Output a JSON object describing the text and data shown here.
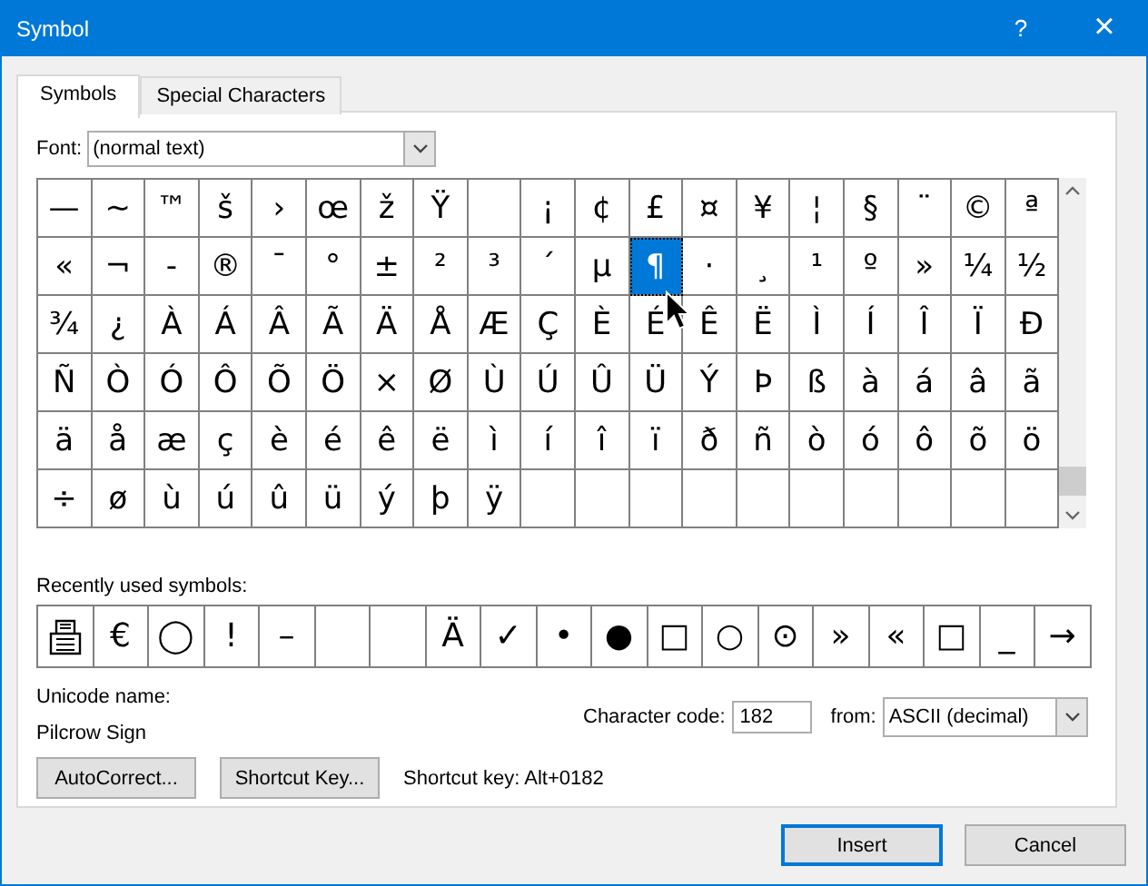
{
  "window": {
    "title": "Symbol",
    "help": "?",
    "close": "×"
  },
  "tabs": [
    {
      "label": "Symbols",
      "selected": true
    },
    {
      "label": "Special Characters",
      "selected": false
    }
  ],
  "font": {
    "label": "Font:",
    "value": "(normal text)"
  },
  "grid": {
    "rows": [
      [
        {
          "char": "—",
          "selected": false
        },
        {
          "char": "~",
          "selected": false
        },
        {
          "char": "™",
          "selected": false
        },
        {
          "char": "š",
          "selected": false
        },
        {
          "char": "›",
          "selected": false
        },
        {
          "char": "œ",
          "selected": false
        },
        {
          "char": "ž",
          "selected": false
        },
        {
          "char": "Ÿ",
          "selected": false
        },
        {
          "kind": "blank",
          "selected": false
        },
        {
          "char": "¡",
          "selected": false
        },
        {
          "char": "¢",
          "selected": false
        },
        {
          "char": "£",
          "selected": false
        },
        {
          "char": "¤",
          "selected": false
        },
        {
          "char": "¥",
          "selected": false
        },
        {
          "char": "¦",
          "selected": false
        },
        {
          "char": "§",
          "selected": false
        },
        {
          "char": "¨",
          "selected": false
        },
        {
          "char": "©",
          "selected": false
        },
        {
          "char": "ª",
          "selected": false
        }
      ],
      [
        {
          "char": "«",
          "selected": false
        },
        {
          "char": "¬",
          "selected": false
        },
        {
          "char": "-",
          "selected": false
        },
        {
          "char": "®",
          "selected": false
        },
        {
          "char": "¯",
          "selected": false
        },
        {
          "char": "°",
          "selected": false
        },
        {
          "char": "±",
          "selected": false
        },
        {
          "char": "²",
          "selected": false
        },
        {
          "char": "³",
          "selected": false
        },
        {
          "char": "´",
          "selected": false
        },
        {
          "char": "µ",
          "selected": false
        },
        {
          "char": "¶",
          "selected": true
        },
        {
          "char": "·",
          "selected": false
        },
        {
          "char": "¸",
          "selected": false
        },
        {
          "char": "¹",
          "selected": false
        },
        {
          "char": "º",
          "selected": false
        },
        {
          "char": "»",
          "selected": false
        },
        {
          "char": "¼",
          "selected": false
        },
        {
          "char": "½",
          "selected": false
        }
      ],
      [
        {
          "char": "¾",
          "selected": false
        },
        {
          "char": "¿",
          "selected": false
        },
        {
          "char": "À",
          "selected": false
        },
        {
          "char": "Á",
          "selected": false
        },
        {
          "char": "Â",
          "selected": false
        },
        {
          "char": "Ã",
          "selected": false
        },
        {
          "char": "Ä",
          "selected": false
        },
        {
          "char": "Å",
          "selected": false
        },
        {
          "char": "Æ",
          "selected": false
        },
        {
          "char": "Ç",
          "selected": false
        },
        {
          "char": "È",
          "selected": false
        },
        {
          "char": "É",
          "selected": false
        },
        {
          "char": "Ê",
          "selected": false
        },
        {
          "char": "Ë",
          "selected": false
        },
        {
          "char": "Ì",
          "selected": false
        },
        {
          "char": "Í",
          "selected": false
        },
        {
          "char": "Î",
          "selected": false
        },
        {
          "char": "Ï",
          "selected": false
        },
        {
          "char": "Ð",
          "selected": false
        }
      ],
      [
        {
          "char": "Ñ",
          "selected": false
        },
        {
          "char": "Ò",
          "selected": false
        },
        {
          "char": "Ó",
          "selected": false
        },
        {
          "char": "Ô",
          "selected": false
        },
        {
          "char": "Õ",
          "selected": false
        },
        {
          "char": "Ö",
          "selected": false
        },
        {
          "char": "×",
          "selected": false
        },
        {
          "char": "Ø",
          "selected": false
        },
        {
          "char": "Ù",
          "selected": false
        },
        {
          "char": "Ú",
          "selected": false
        },
        {
          "char": "Û",
          "selected": false
        },
        {
          "char": "Ü",
          "selected": false
        },
        {
          "char": "Ý",
          "selected": false
        },
        {
          "char": "Þ",
          "selected": false
        },
        {
          "char": "ß",
          "selected": false
        },
        {
          "char": "à",
          "selected": false
        },
        {
          "char": "á",
          "selected": false
        },
        {
          "char": "â",
          "selected": false
        },
        {
          "char": "ã",
          "selected": false
        }
      ],
      [
        {
          "char": "ä",
          "selected": false
        },
        {
          "char": "å",
          "selected": false
        },
        {
          "char": "æ",
          "selected": false
        },
        {
          "char": "ç",
          "selected": false
        },
        {
          "char": "è",
          "selected": false
        },
        {
          "char": "é",
          "selected": false
        },
        {
          "char": "ê",
          "selected": false
        },
        {
          "char": "ë",
          "selected": false
        },
        {
          "char": "ì",
          "selected": false
        },
        {
          "char": "í",
          "selected": false
        },
        {
          "char": "î",
          "selected": false
        },
        {
          "char": "ï",
          "selected": false
        },
        {
          "char": "ð",
          "selected": false
        },
        {
          "char": "ñ",
          "selected": false
        },
        {
          "char": "ò",
          "selected": false
        },
        {
          "char": "ó",
          "selected": false
        },
        {
          "char": "ô",
          "selected": false
        },
        {
          "char": "õ",
          "selected": false
        },
        {
          "char": "ö",
          "selected": false
        }
      ],
      [
        {
          "char": "÷",
          "selected": false
        },
        {
          "char": "ø",
          "selected": false
        },
        {
          "char": "ù",
          "selected": false
        },
        {
          "char": "ú",
          "selected": false
        },
        {
          "char": "û",
          "selected": false
        },
        {
          "char": "ü",
          "selected": false
        },
        {
          "char": "ý",
          "selected": false
        },
        {
          "char": "þ",
          "selected": false
        },
        {
          "char": "ÿ",
          "selected": false
        },
        {
          "kind": "blank",
          "selected": false
        },
        {
          "kind": "blank",
          "selected": false
        },
        {
          "kind": "blank",
          "selected": false
        },
        {
          "kind": "blank",
          "selected": false
        },
        {
          "kind": "blank",
          "selected": false
        },
        {
          "kind": "blank",
          "selected": false
        },
        {
          "kind": "blank",
          "selected": false
        },
        {
          "kind": "blank",
          "selected": false
        },
        {
          "kind": "blank",
          "selected": false
        },
        {
          "kind": "blank",
          "selected": false
        }
      ]
    ]
  },
  "recent": {
    "label": "Recently used symbols:",
    "items": [
      {
        "kind": "icon"
      },
      {
        "kind": "char",
        "char": "€"
      },
      {
        "kind": "char",
        "char": "◯"
      },
      {
        "kind": "char",
        "char": "!"
      },
      {
        "kind": "char",
        "char": "–"
      },
      {
        "kind": "blank"
      },
      {
        "kind": "blank"
      },
      {
        "kind": "char",
        "char": "Ä"
      },
      {
        "kind": "char",
        "char": "✓"
      },
      {
        "kind": "char",
        "char": "•"
      },
      {
        "kind": "char",
        "char": "●"
      },
      {
        "kind": "char",
        "char": "□"
      },
      {
        "kind": "char",
        "char": "○"
      },
      {
        "kind": "char",
        "char": "⊙"
      },
      {
        "kind": "char",
        "char": "»"
      },
      {
        "kind": "char",
        "char": "«"
      },
      {
        "kind": "char",
        "char": "□"
      },
      {
        "kind": "char",
        "char": "_"
      },
      {
        "kind": "char",
        "char": "→"
      }
    ]
  },
  "unicode_name": {
    "label": "Unicode name:",
    "value": "Pilcrow Sign"
  },
  "character_code": {
    "label": "Character code:",
    "value": "182"
  },
  "from": {
    "label": "from:",
    "value": "ASCII (decimal)"
  },
  "buttons": [
    {
      "label": "AutoCorrect..."
    },
    {
      "label": "Shortcut Key..."
    }
  ],
  "shortcut_key": "Shortcut key: Alt+0182",
  "footer_buttons": [
    {
      "label": "Insert",
      "default": true
    },
    {
      "label": "Cancel",
      "default": false
    }
  ]
}
